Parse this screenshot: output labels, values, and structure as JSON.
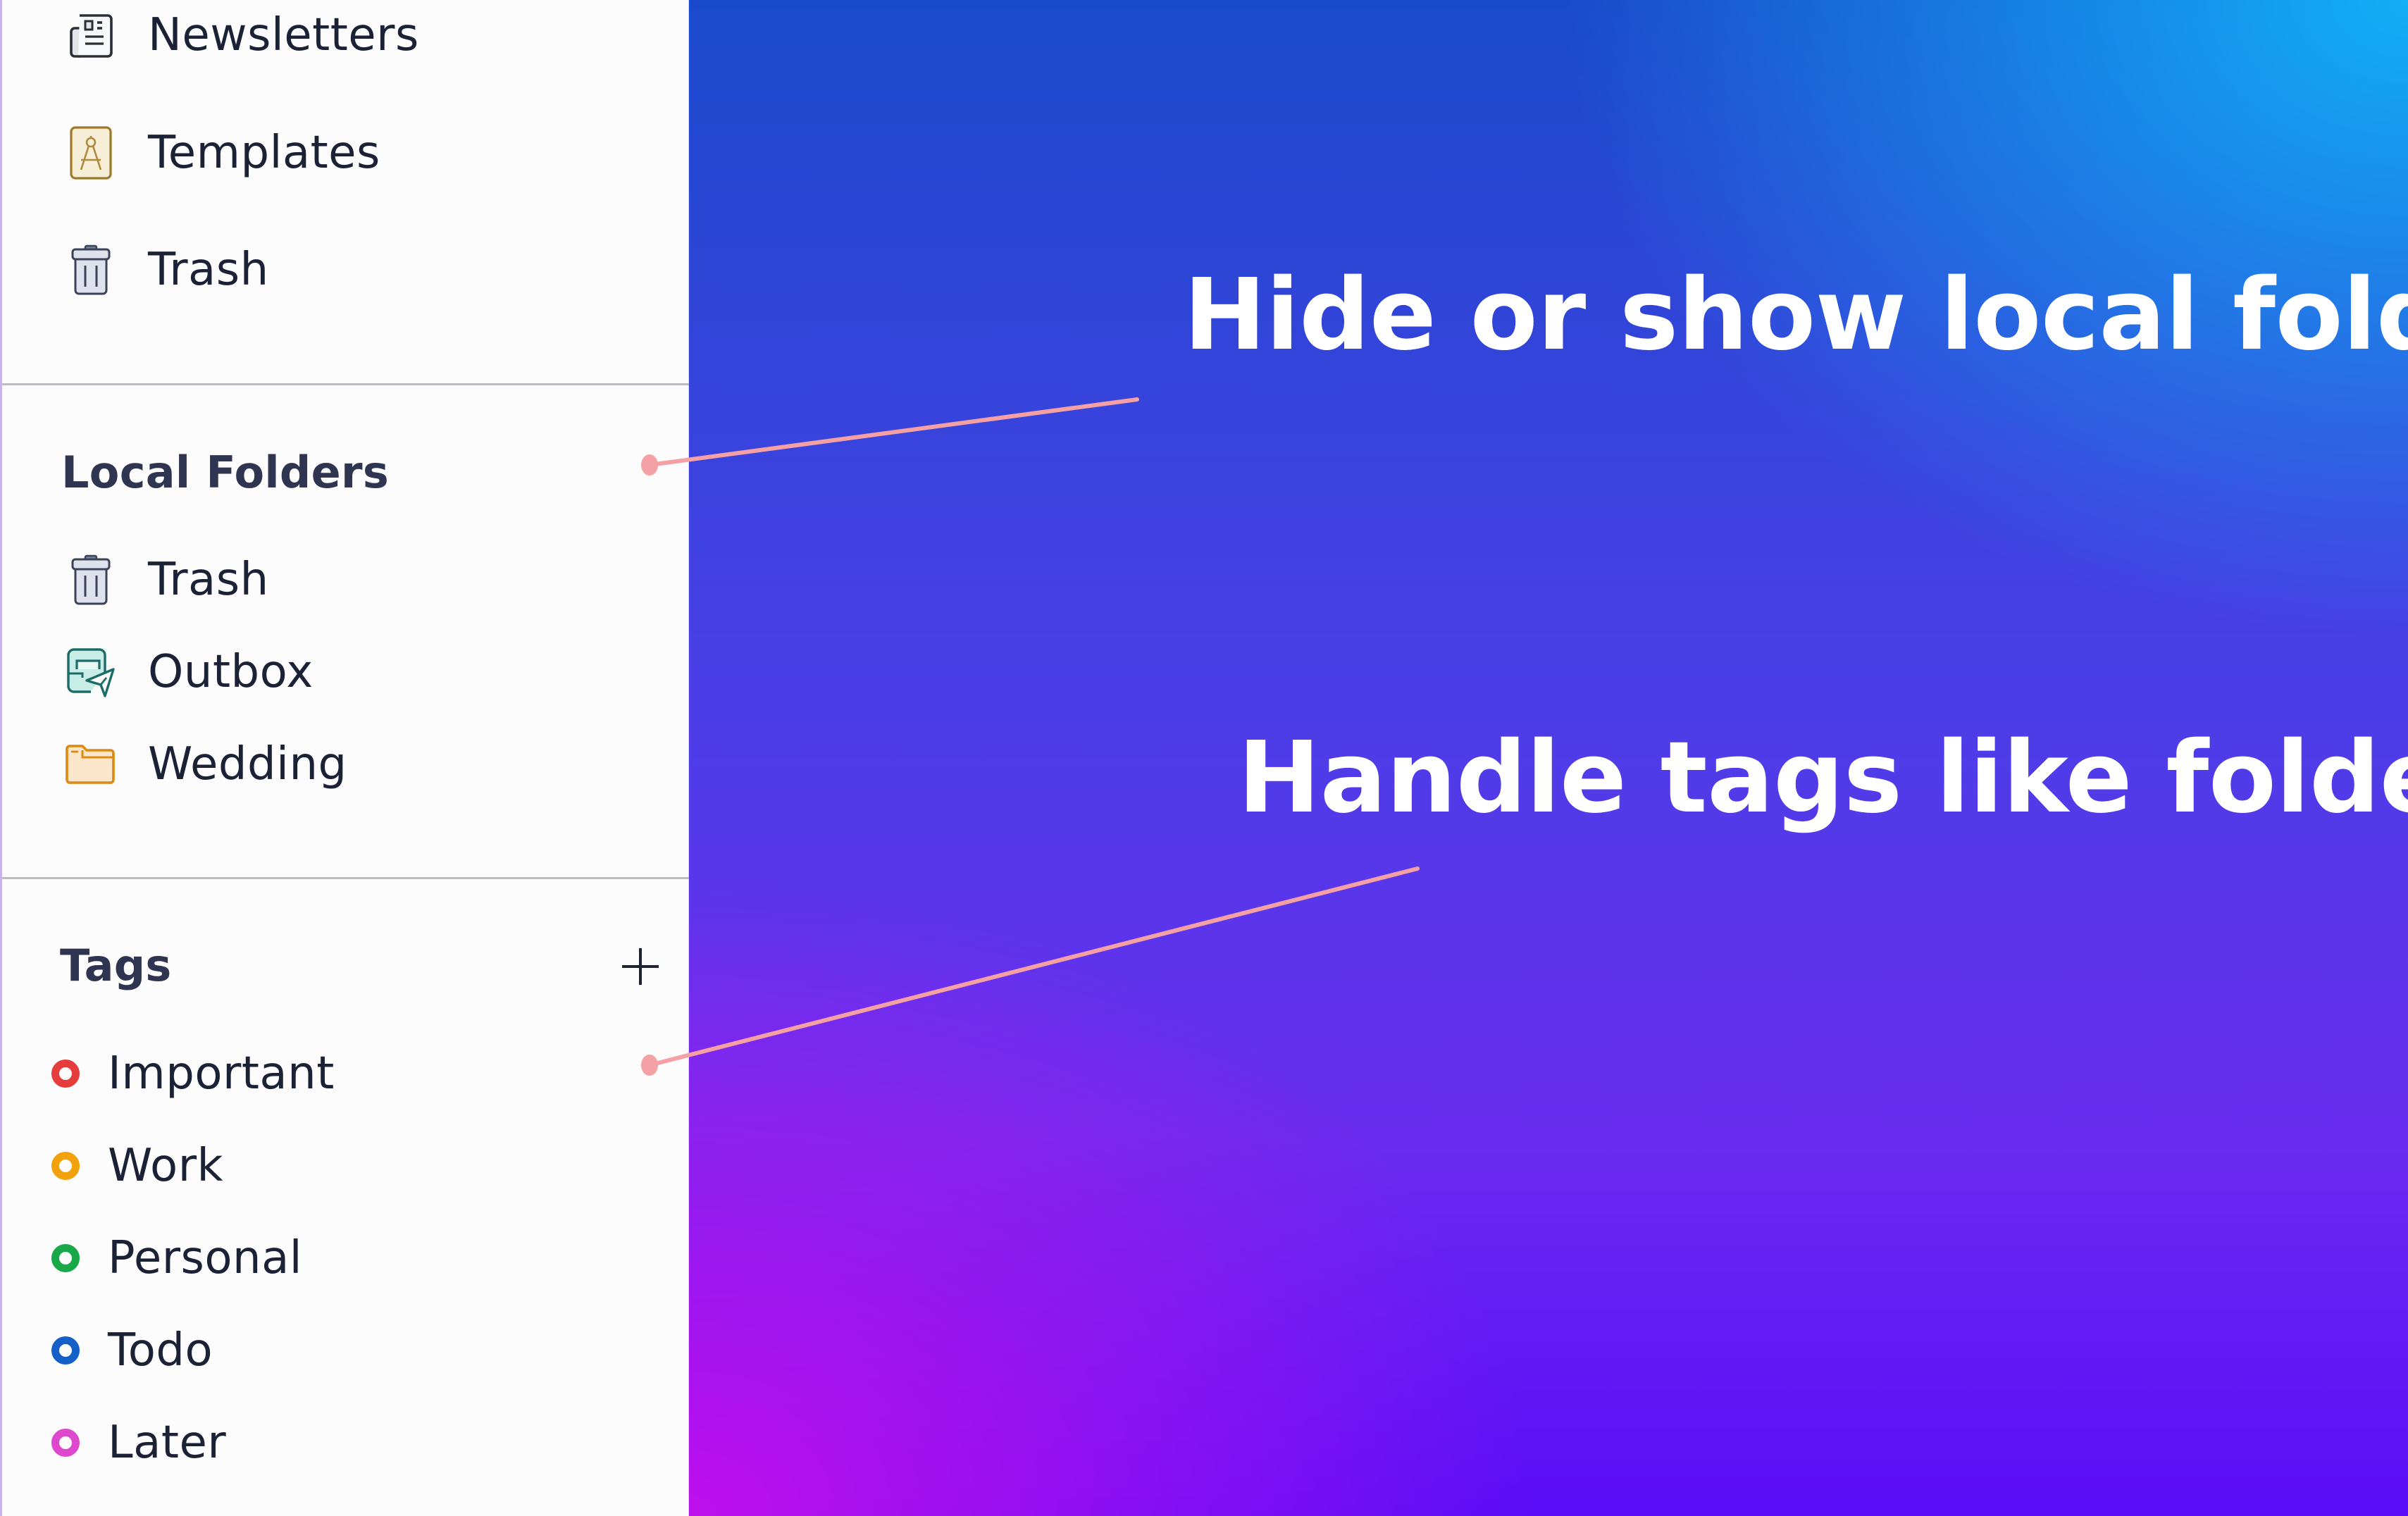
{
  "sidebar": {
    "top_items": [
      {
        "label": "Newsletters",
        "icon": "newsletter-icon"
      },
      {
        "label": "Templates",
        "icon": "templates-compass-icon"
      },
      {
        "label": "Trash",
        "icon": "trash-icon"
      }
    ],
    "local_folders": {
      "title": "Local Folders",
      "items": [
        {
          "label": "Trash",
          "icon": "trash-icon"
        },
        {
          "label": "Outbox",
          "icon": "outbox-icon"
        },
        {
          "label": "Wedding",
          "icon": "folder-icon"
        }
      ]
    },
    "tags": {
      "title": "Tags",
      "add_icon": "plus-icon",
      "items": [
        {
          "label": "Important",
          "color": "#e53c3c"
        },
        {
          "label": "Work",
          "color": "#f2a20c"
        },
        {
          "label": "Personal",
          "color": "#18a848"
        },
        {
          "label": "Todo",
          "color": "#1460c8"
        },
        {
          "label": "Later",
          "color": "#de48cc"
        }
      ]
    }
  },
  "captions": {
    "local_folders": "Hide or show local folders",
    "tags": "Handle tags like folders"
  },
  "colors": {
    "annotation": "#f4a0a4",
    "gradient": [
      "#1a4acc",
      "#12b4f8",
      "#c410ec",
      "#5a0cf8"
    ]
  }
}
